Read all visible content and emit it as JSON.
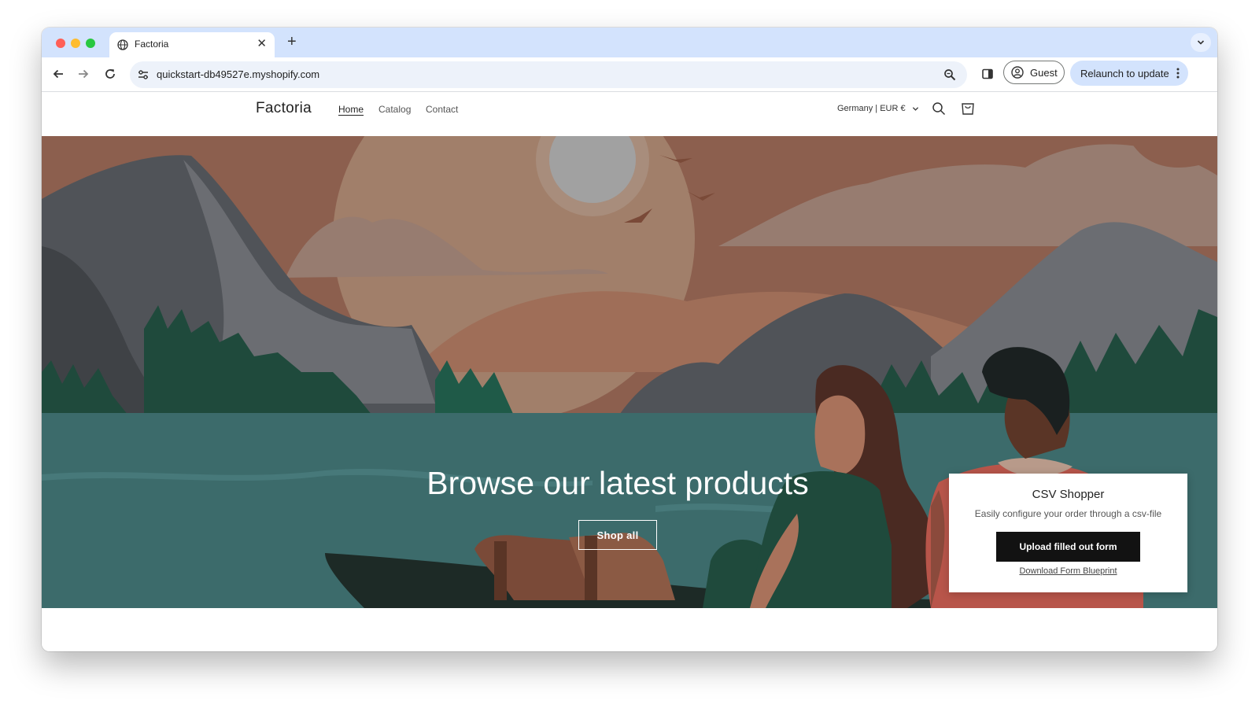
{
  "browser": {
    "tab": {
      "title": "Factoria"
    },
    "address_bar": {
      "url": "quickstart-db49527e.myshopify.com"
    },
    "profile_label": "Guest",
    "relaunch_label": "Relaunch to update"
  },
  "store": {
    "logo": "Factoria",
    "nav": [
      {
        "label": "Home",
        "active": true
      },
      {
        "label": "Catalog",
        "active": false
      },
      {
        "label": "Contact",
        "active": false
      }
    ],
    "locale": "Germany | EUR €"
  },
  "hero": {
    "headline": "Browse our latest products",
    "button_label": "Shop all"
  },
  "csv_popup": {
    "title": "CSV Shopper",
    "description": "Easily configure your order through a csv-file",
    "upload_label": "Upload filled out form",
    "download_label": "Download Form Blueprint"
  },
  "colors": {
    "tabstrip": "#d3e3fd",
    "sky": "#8c5f4e",
    "lake": "#3c6b6b",
    "button_dark": "#121212"
  },
  "icons": [
    "globe-icon",
    "close-icon",
    "plus-icon",
    "chevron-down-icon",
    "back-arrow-icon",
    "forward-arrow-icon",
    "reload-icon",
    "tune-icon",
    "zoom-icon",
    "side-panel-icon",
    "person-icon",
    "more-vert-icon",
    "search-icon",
    "cart-icon"
  ]
}
